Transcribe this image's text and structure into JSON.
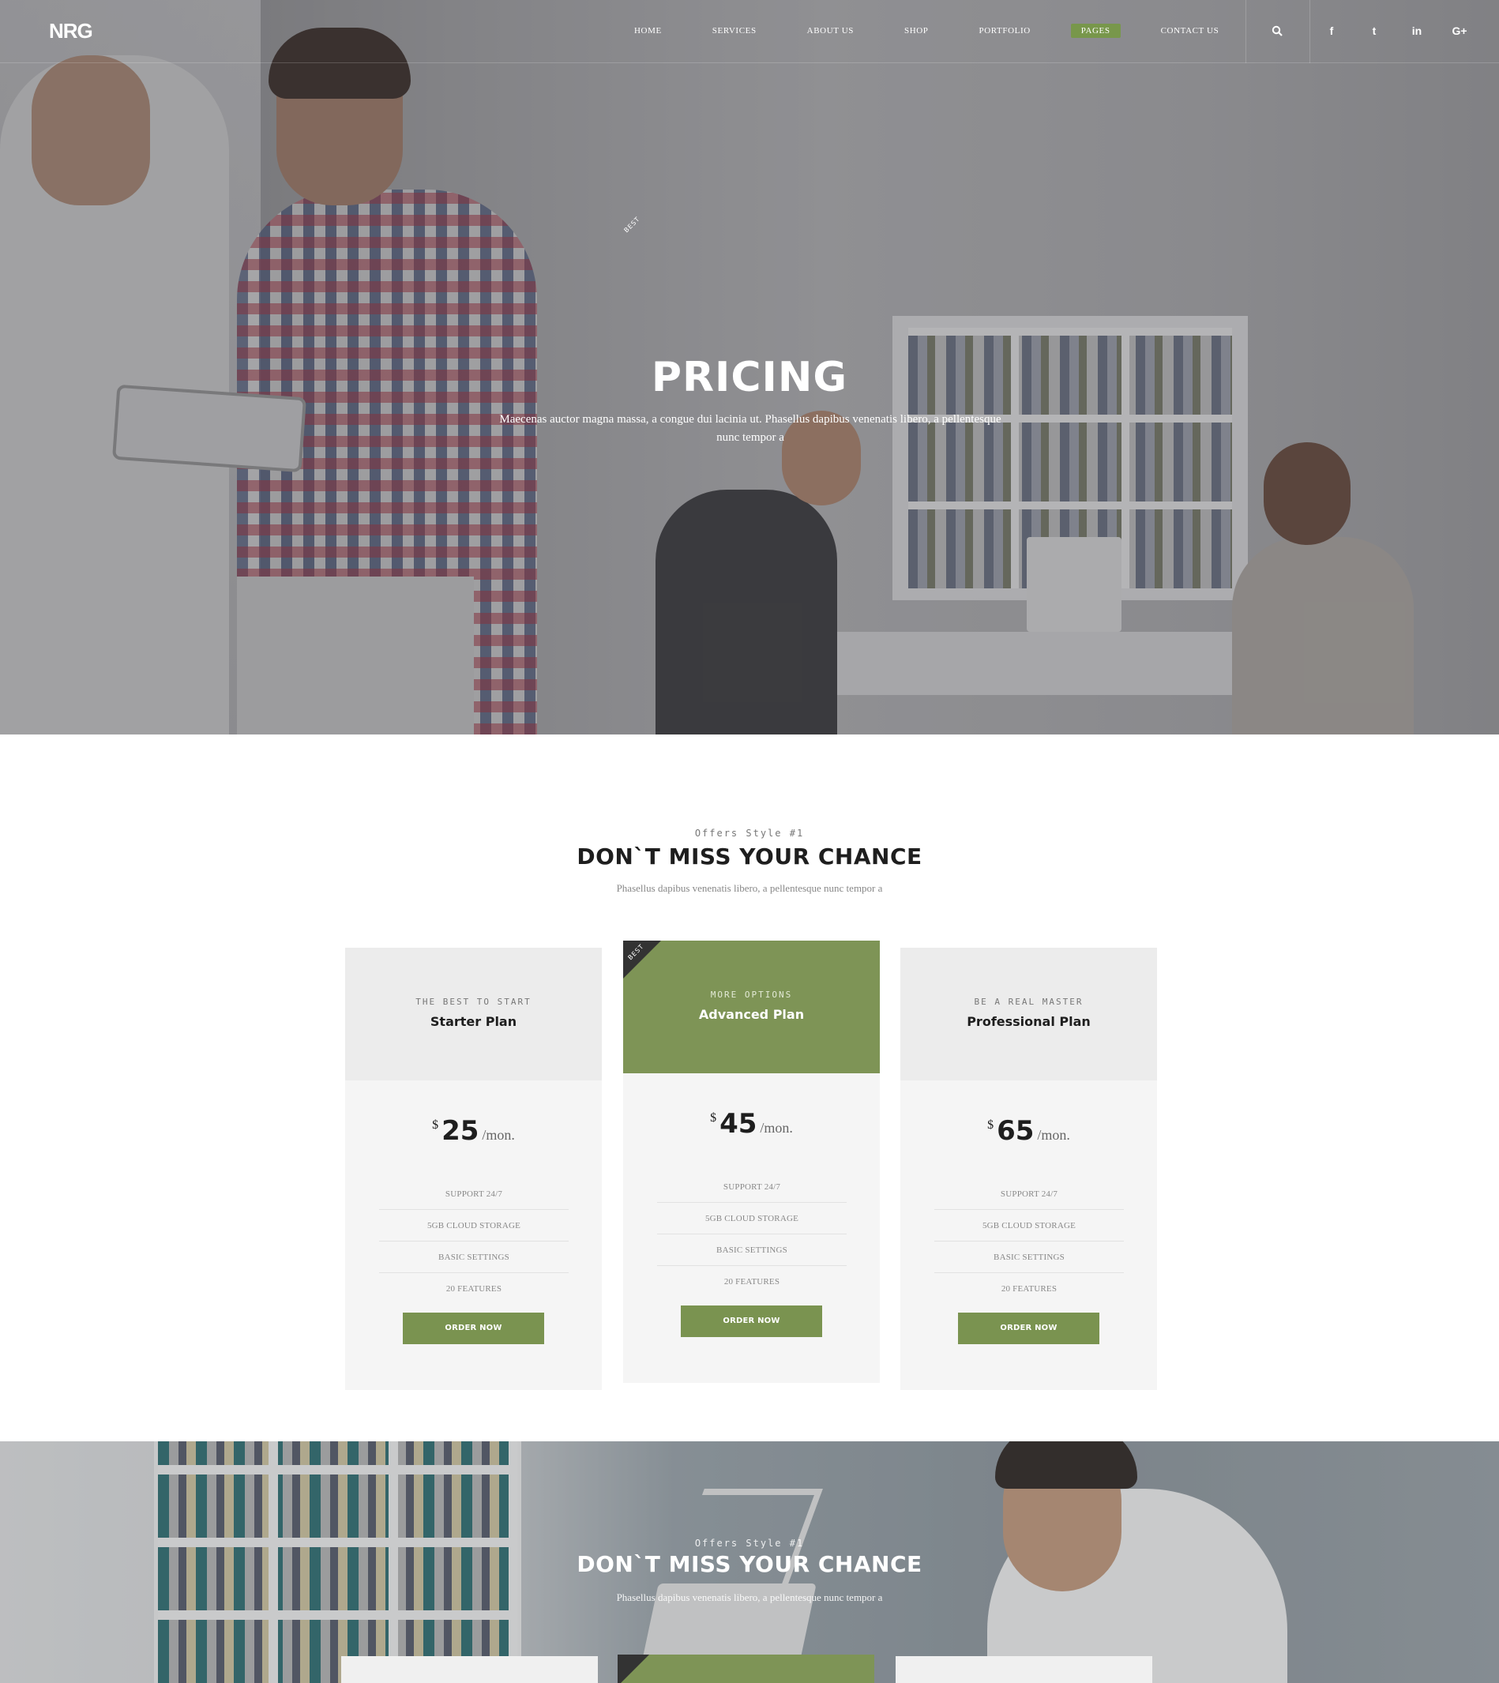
{
  "nav": {
    "logo": "NRG",
    "menu": [
      "HOME",
      "SERVICES",
      "ABOUT US",
      "SHOP",
      "PORTFOLIO",
      "PAGES",
      "CONTACT US"
    ],
    "active_item": "PAGES",
    "accent_color": "#78974b",
    "icons": [
      "search-icon",
      "facebook-icon",
      "twitter-icon",
      "linkedin-icon",
      "google-plus-icon"
    ],
    "icon_glyphs": {
      "facebook": "f",
      "twitter": "t",
      "linkedin": "in",
      "google_plus": "G+"
    }
  },
  "hero": {
    "title": "PRICING",
    "subtitle": "Maecenas auctor magna massa, a congue dui lacinia ut. Phasellus dapibus venenatis libero, a pellentesque nunc tempor a"
  },
  "offers": {
    "eyebrow": "Offers Style #1",
    "title": "DON`T MISS YOUR CHANCE",
    "subtitle": "Phasellus dapibus venenatis libero, a pellentesque nunc tempor a",
    "plans": [
      {
        "eyebrow": "THE BEST TO START",
        "name": "Starter Plan",
        "currency": "$",
        "price": "25",
        "period": "/mon.",
        "features": [
          "SUPPORT 24/7",
          "5GB CLOUD STORAGE",
          "BASIC SETTINGS",
          "20 FEATURES"
        ],
        "button": "ORDER NOW"
      },
      {
        "eyebrow": "MORE OPTIONS",
        "name": "Advanced Plan",
        "ribbon": "BEST",
        "currency": "$",
        "price": "45",
        "period": "/mon.",
        "features": [
          "SUPPORT 24/7",
          "5GB CLOUD STORAGE",
          "BASIC SETTINGS",
          "20 FEATURES"
        ],
        "button": "ORDER NOW"
      },
      {
        "eyebrow": "BE A REAL MASTER",
        "name": "Professional Plan",
        "currency": "$",
        "price": "65",
        "period": "/mon.",
        "features": [
          "SUPPORT 24/7",
          "5GB CLOUD STORAGE",
          "BASIC SETTINGS",
          "20 FEATURES"
        ],
        "button": "ORDER NOW"
      }
    ]
  },
  "offers2": {
    "eyebrow": "Offers Style #1",
    "title": "DON`T MISS YOUR CHANCE",
    "subtitle": "Phasellus dapibus venenatis libero, a pellentesque nunc tempor a",
    "ribbon": "BEST"
  },
  "colors": {
    "green": "#7a9350",
    "card_bg": "#f5f5f5",
    "card_head": "#ececec",
    "title_dark": "#1e1e1e"
  }
}
